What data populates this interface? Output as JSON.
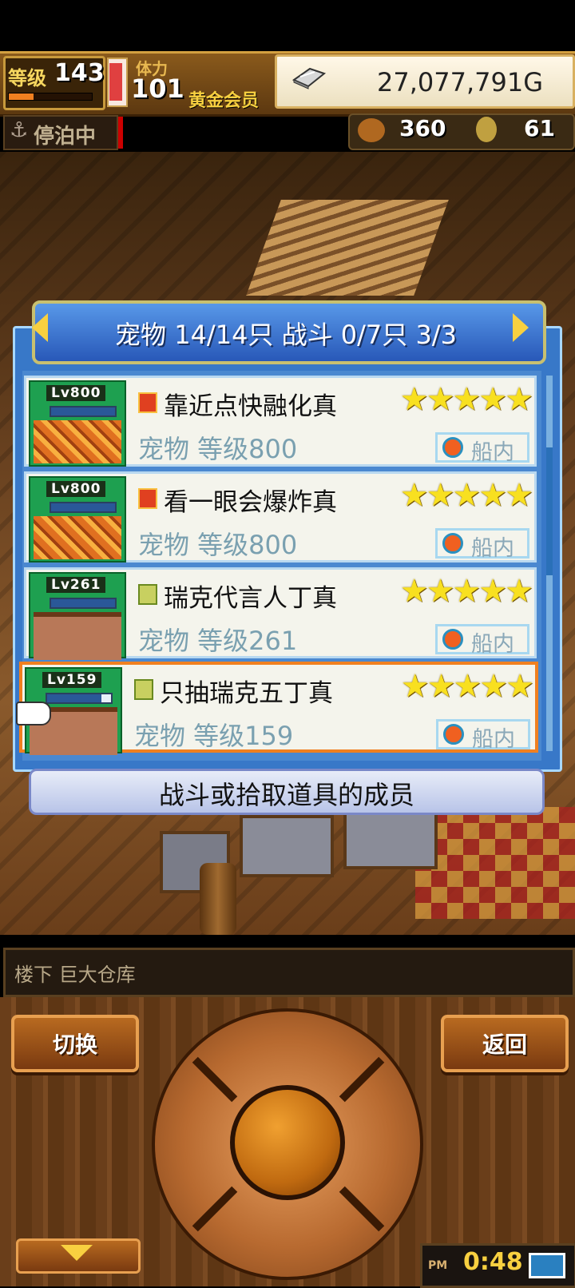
{
  "hud": {
    "level_label": "等级",
    "level_value": "143",
    "exp_percent": 30,
    "hp_percent": 95,
    "stamina_label": "体力",
    "stamina_value": "101",
    "vip_label": "黄金会员",
    "gold_value": "27,077,791G",
    "dock_status": "停泊中",
    "food_value": "360",
    "medal_value": "61"
  },
  "panel": {
    "header": "宠物 14/14只 战斗 0/7只  3/3",
    "pets": [
      {
        "lv_badge": "Lv800",
        "element": "fire",
        "name": "靠近点快融化真",
        "stars": "★★★★★",
        "level_text": "宠物 等级800",
        "location": "船内",
        "hp_percent": 100,
        "art": "dragon"
      },
      {
        "lv_badge": "Lv800",
        "element": "fire",
        "name": "看一眼会爆炸真",
        "stars": "★★★★★",
        "level_text": "宠物 等级800",
        "location": "船内",
        "hp_percent": 100,
        "art": "dragon"
      },
      {
        "lv_badge": "Lv261",
        "element": "wind",
        "name": "瑞克代言人丁真",
        "stars": "★★★★★",
        "level_text": "宠物 等级261",
        "location": "船内",
        "hp_percent": 100,
        "art": "face"
      },
      {
        "lv_badge": "Lv159",
        "element": "wind",
        "name": "只抽瑞克五丁真",
        "stars": "★★★★★",
        "level_text": "宠物 等级159",
        "location": "船内",
        "hp_percent": 85,
        "art": "face"
      }
    ],
    "footer_label": "战斗或拾取道具的成员"
  },
  "location_bar": "楼下 巨大仓库",
  "controls": {
    "switch_label": "切换",
    "back_label": "返回"
  },
  "clock": {
    "ampm": "PM",
    "time": "0:48"
  }
}
